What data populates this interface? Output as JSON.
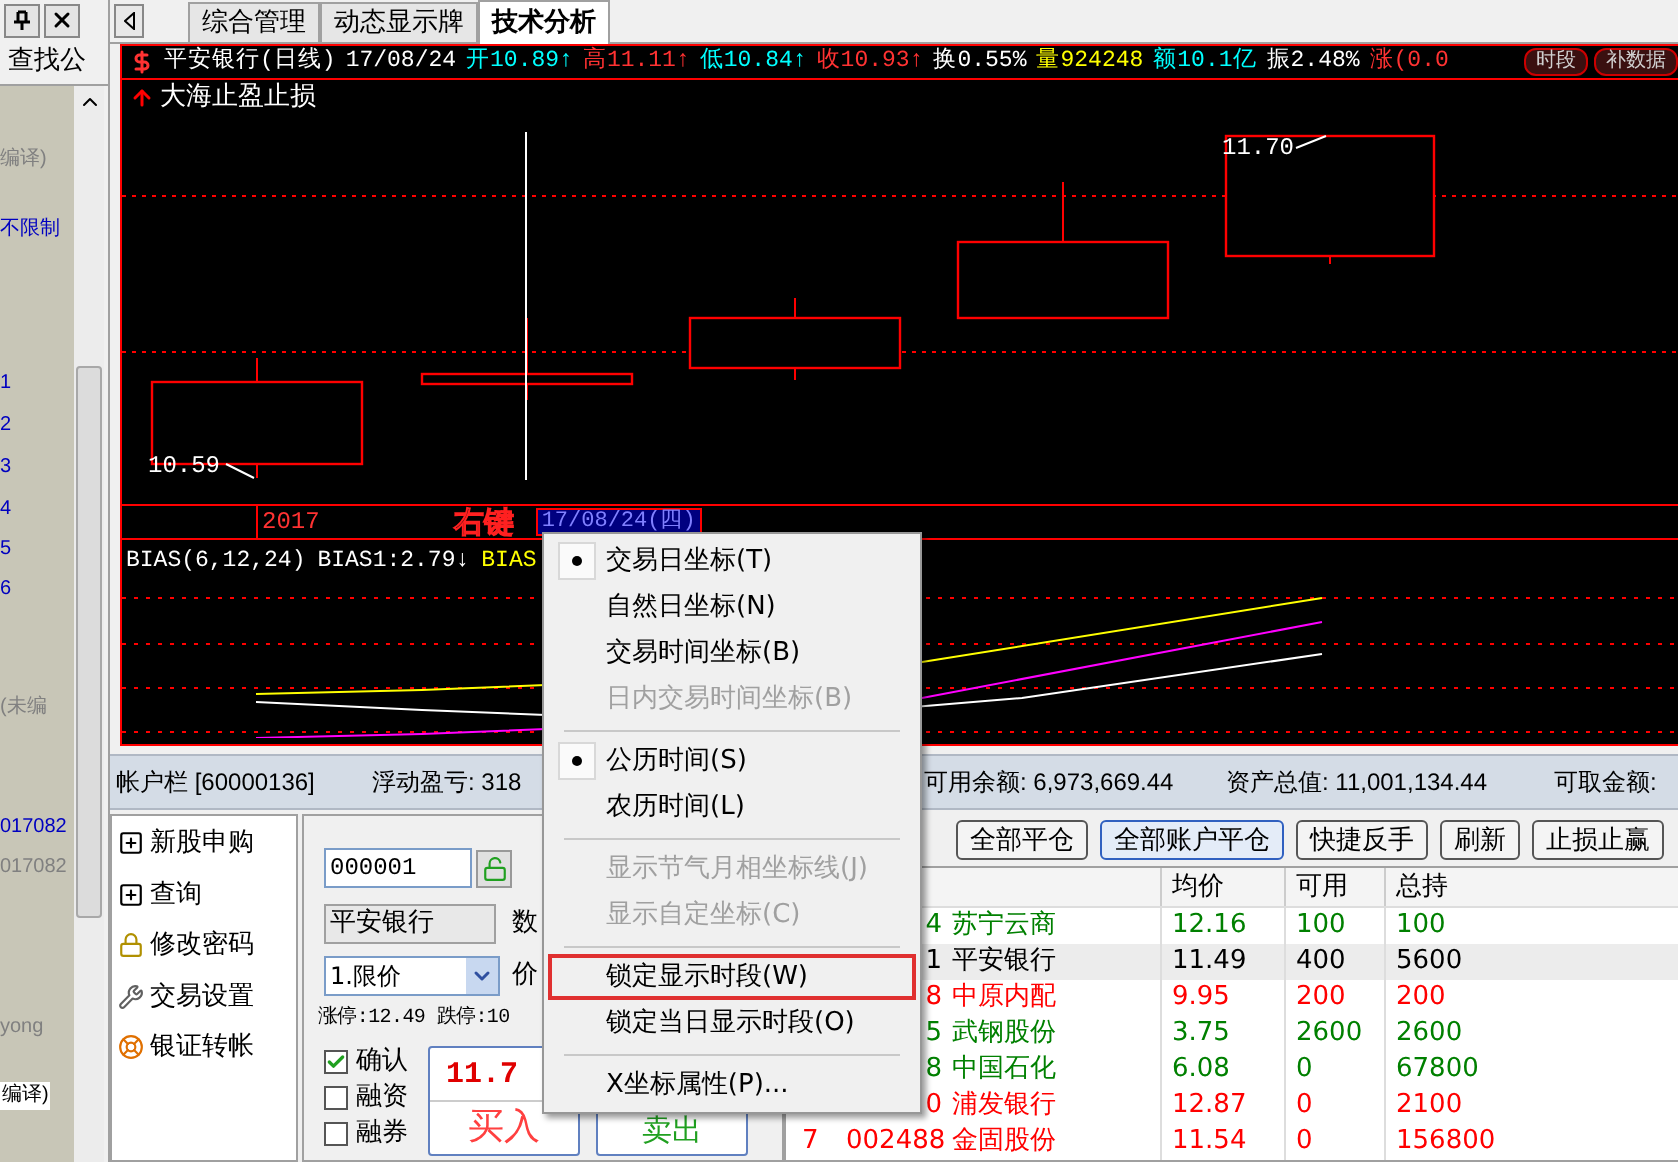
{
  "left_panel": {
    "search_label": "查找公",
    "items": [
      {
        "text": "编译)",
        "color": "#808080",
        "kind": "plain"
      },
      {
        "text": "不限制",
        "color": "#0000c0",
        "kind": "plain"
      },
      {
        "text": "1",
        "color": "#0000c0",
        "kind": "plain"
      },
      {
        "text": "2",
        "color": "#0000c0",
        "kind": "plain"
      },
      {
        "text": "3",
        "color": "#0000c0",
        "kind": "plain"
      },
      {
        "text": "4",
        "color": "#0000c0",
        "kind": "plain"
      },
      {
        "text": "5",
        "color": "#0000c0",
        "kind": "plain"
      },
      {
        "text": "6",
        "color": "#0000c0",
        "kind": "plain"
      },
      {
        "text": "(未编",
        "color": "#808080",
        "kind": "plain"
      },
      {
        "text": "017082",
        "color": "#0000c0",
        "kind": "plain"
      },
      {
        "text": "017082",
        "color": "#808080",
        "kind": "plain"
      },
      {
        "text": "yong",
        "color": "#808080",
        "kind": "plain"
      },
      {
        "text": "编译)",
        "color": "#000000",
        "kind": "boxed"
      }
    ]
  },
  "tabs": [
    {
      "label": "综合管理",
      "selected": false
    },
    {
      "label": "动态显示牌",
      "selected": false
    },
    {
      "label": "技术分析",
      "selected": true
    }
  ],
  "quote_header": {
    "title": "平安银行(日线)",
    "date": "17/08/24",
    "fields": [
      {
        "text": "开10.89↑",
        "color": "#00ffff"
      },
      {
        "text": "高11.11↑",
        "color": "#ff3232"
      },
      {
        "text": "低10.84↑",
        "color": "#00ffff"
      },
      {
        "text": "收10.93↑",
        "color": "#ff3232"
      },
      {
        "text": "换0.55%",
        "color": "#ffffff"
      },
      {
        "text": "量924248",
        "color": "#ffff00"
      },
      {
        "text": "额10.1亿",
        "color": "#00ffff"
      },
      {
        "text": "振2.48%",
        "color": "#ffffff"
      },
      {
        "text": "涨(0.0",
        "color": "#ff3232"
      }
    ],
    "buttons": [
      "时段",
      "补数据"
    ]
  },
  "indicator_note": "大海止盈止损",
  "price_chart": {
    "low_label": "10.59",
    "high_label": "11.70",
    "year_label": "2017",
    "cursor_date": "17/08/24(四)",
    "annotation": "右键"
  },
  "bias_panel": {
    "title": "BIAS(6,12,24)",
    "values": [
      {
        "text": "BIAS1:2.79↓",
        "color": "#ffffff"
      },
      {
        "text": "BIAS",
        "color": "#ffff00"
      }
    ]
  },
  "account_bar": {
    "title": "帐户栏 [60000136]",
    "fields": [
      "浮动盈亏: 318",
      "可用余额: 6,973,669.44",
      "资产总值: 11,001,134.44",
      "可取金额:"
    ]
  },
  "nav_tree": [
    {
      "label": "新股申购",
      "kind": "expand"
    },
    {
      "label": "查询",
      "kind": "expand"
    },
    {
      "label": "修改密码",
      "kind": "lock"
    },
    {
      "label": "交易设置",
      "kind": "wrench"
    },
    {
      "label": "银证转帐",
      "kind": "ring"
    }
  ],
  "order_form": {
    "code": "000001",
    "name": "平安银行",
    "quantity_label": "数",
    "order_type": "1.限价",
    "price_label": "价",
    "limits": "涨停:12.49 跌停:10",
    "options": [
      {
        "label": "确认",
        "checked": true
      },
      {
        "label": "融资",
        "checked": false
      },
      {
        "label": "融券",
        "checked": false
      }
    ],
    "buy_price": "11.7",
    "buy_label": "买入",
    "sell_label": "卖出"
  },
  "actions": [
    {
      "label": "全部平仓",
      "selected": false
    },
    {
      "label": "全部账户平仓",
      "selected": true
    },
    {
      "label": "快捷反手",
      "selected": false
    },
    {
      "label": "刷新",
      "selected": false
    },
    {
      "label": "止损止赢",
      "selected": false
    }
  ],
  "positions": {
    "columns": [
      "均价",
      "可用",
      "总持"
    ],
    "rows": [
      {
        "code": "4",
        "name": "苏宁云商",
        "avg": "12.16",
        "available": "100",
        "total": "100",
        "color": "#008000",
        "selected": false
      },
      {
        "code": "1",
        "name": "平安银行",
        "avg": "11.49",
        "available": "400",
        "total": "5600",
        "color": "#000000",
        "selected": true
      },
      {
        "code": "8",
        "name": "中原内配",
        "avg": "9.95",
        "available": "200",
        "total": "200",
        "color": "#ff0000",
        "selected": false
      },
      {
        "code": "5",
        "name": "武钢股份",
        "avg": "3.75",
        "available": "2600",
        "total": "2600",
        "color": "#008000",
        "selected": false
      },
      {
        "code": "8",
        "name": "中国石化",
        "avg": "6.08",
        "available": "0",
        "total": "67800",
        "color": "#008000",
        "selected": false
      },
      {
        "code": "0",
        "name": "浦发银行",
        "avg": "12.87",
        "available": "0",
        "total": "2100",
        "color": "#ff0000",
        "selected": false
      },
      {
        "index": "7",
        "code": "002488",
        "name": "金固股份",
        "avg": "11.54",
        "available": "0",
        "total": "156800",
        "color": "#ff0000",
        "selected": false
      }
    ]
  },
  "context_menu": [
    {
      "kind": "item",
      "label": "交易日坐标(T)",
      "checked": true,
      "disabled": false,
      "highlighted": false
    },
    {
      "kind": "item",
      "label": "自然日坐标(N)",
      "checked": false,
      "disabled": false,
      "highlighted": false
    },
    {
      "kind": "item",
      "label": "交易时间坐标(B)",
      "checked": false,
      "disabled": false,
      "highlighted": false
    },
    {
      "kind": "item",
      "label": "日内交易时间坐标(B)",
      "checked": false,
      "disabled": true,
      "highlighted": false
    },
    {
      "kind": "separator"
    },
    {
      "kind": "item",
      "label": "公历时间(S)",
      "checked": true,
      "disabled": false,
      "highlighted": false
    },
    {
      "kind": "item",
      "label": "农历时间(L)",
      "checked": false,
      "disabled": false,
      "highlighted": false
    },
    {
      "kind": "separator"
    },
    {
      "kind": "item",
      "label": "显示节气月相坐标线(J)",
      "checked": false,
      "disabled": true,
      "highlighted": false
    },
    {
      "kind": "item",
      "label": "显示自定坐标(C)",
      "checked": false,
      "disabled": true,
      "highlighted": false
    },
    {
      "kind": "separator"
    },
    {
      "kind": "item",
      "label": "锁定显示时段(W)",
      "checked": false,
      "disabled": false,
      "highlighted": true
    },
    {
      "kind": "item",
      "label": "锁定当日显示时段(O)",
      "checked": false,
      "disabled": false,
      "highlighted": false
    },
    {
      "kind": "separator"
    },
    {
      "kind": "item",
      "label": "X坐标属性(P)...",
      "checked": false,
      "disabled": false,
      "highlighted": false
    }
  ]
}
